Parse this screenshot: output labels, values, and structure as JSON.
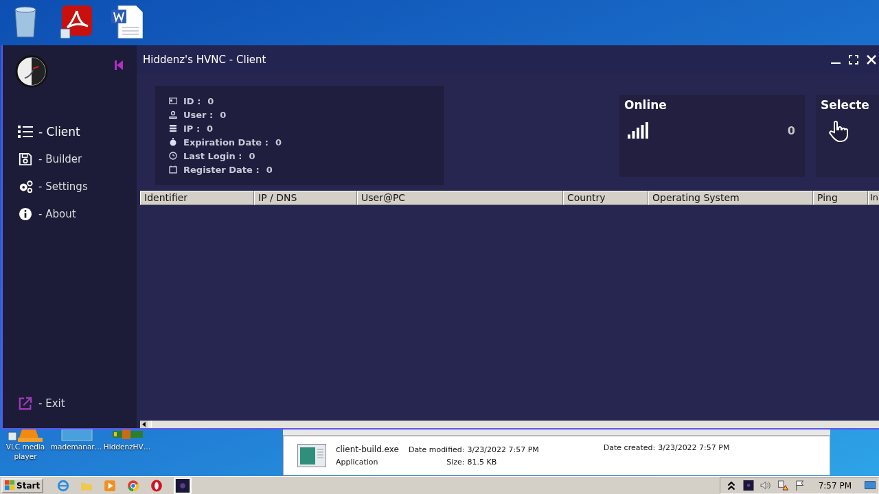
{
  "window": {
    "title": "Hiddenz's HVNC - Client"
  },
  "sidebar": {
    "items": [
      {
        "label": "- Client",
        "selected": true
      },
      {
        "label": "- Builder",
        "selected": false
      },
      {
        "label": "- Settings",
        "selected": false
      },
      {
        "label": "- About",
        "selected": false
      }
    ],
    "exit": "- Exit"
  },
  "info": [
    {
      "label": "ID :",
      "value": "0"
    },
    {
      "label": "User :",
      "value": "0"
    },
    {
      "label": "IP :",
      "value": "0"
    },
    {
      "label": "Expiration Date :",
      "value": "0"
    },
    {
      "label": "Last Login :",
      "value": "0"
    },
    {
      "label": "Register Date :",
      "value": "0"
    }
  ],
  "online": {
    "title": "Online",
    "count": "0"
  },
  "selected_card": {
    "title": "Selecte"
  },
  "table": {
    "columns": [
      "Identifier",
      "IP / DNS",
      "User@PC",
      "Country",
      "Operating System",
      "Ping",
      "In"
    ]
  },
  "desktop_icons": [
    {
      "label": "VLC media player"
    },
    {
      "label": "mademanar…"
    },
    {
      "label": "HiddenzHV…"
    }
  ],
  "details": {
    "name": "client-build.exe",
    "type": "Application",
    "modified_label": "Date modified:",
    "modified": "3/23/2022 7:57 PM",
    "size_label": "Size:",
    "size": "81.5 KB",
    "created_label": "Date created:",
    "created": "3/23/2022 7:57 PM"
  },
  "taskbar": {
    "start": "Start",
    "clock": "7:57 PM"
  }
}
